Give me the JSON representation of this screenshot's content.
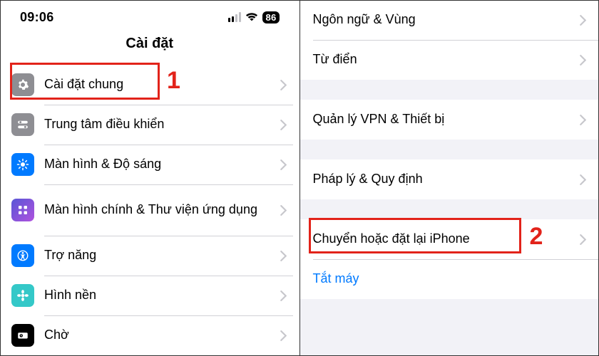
{
  "status": {
    "time": "09:06",
    "battery": "86"
  },
  "left": {
    "title": "Cài đặt",
    "rows": {
      "general": "Cài đặt chung",
      "control_center": "Trung tâm điều khiển",
      "display": "Màn hình & Độ sáng",
      "home_screen": "Màn hình chính & Thư viện ứng dụng",
      "accessibility": "Trợ năng",
      "wallpaper": "Hình nền",
      "standby": "Chờ"
    },
    "annotation": "1"
  },
  "right": {
    "rows": {
      "language": "Ngôn ngữ & Vùng",
      "dictionary": "Từ điển",
      "vpn": "Quản lý VPN & Thiết bị",
      "legal": "Pháp lý & Quy định",
      "transfer_reset": "Chuyển hoặc đặt lại iPhone",
      "shutdown": "Tắt máy"
    },
    "annotation": "2"
  }
}
